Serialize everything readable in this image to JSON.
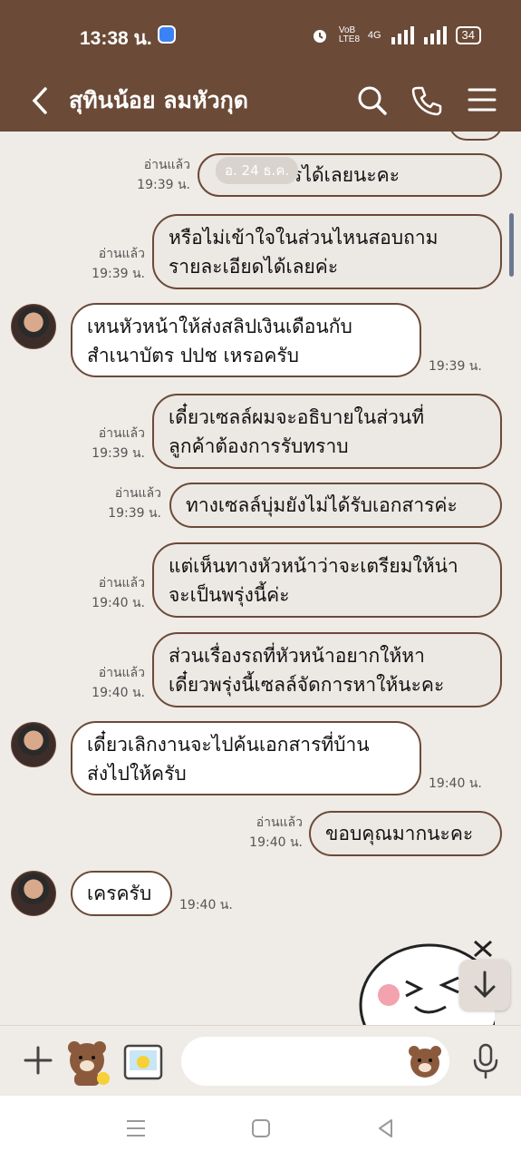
{
  "status": {
    "time": "13:38 น.",
    "network1": "VoB LTE8",
    "network2": "4G",
    "battery": "34"
  },
  "header": {
    "contact_name": "สุทินน้อย ลมหัวกุด"
  },
  "chat": {
    "date_label": "อ. 24 ธ.ค.",
    "messages": [
      {
        "dir": "out",
        "text": "ส่งเอกสารได้เลยนะคะ",
        "read": "อ่านแล้ว",
        "time": "19:39 น."
      },
      {
        "dir": "out",
        "lines": [
          "หรือไม่เข้าใจในส่วนไหนสอบถาม",
          "รายละเอียดได้เลยค่ะ"
        ],
        "read": "อ่านแล้ว",
        "time": "19:39 น."
      },
      {
        "dir": "in",
        "lines": [
          "เหนหัวหน้าให้ส่งสลิปเงินเดือนกับ",
          "สำเนาบัตร ปปช เหรอครับ"
        ],
        "time": "19:39 น."
      },
      {
        "dir": "out",
        "lines": [
          "เดี๋ยวเซลล์ผมจะอธิบายในส่วนที่",
          "ลูกค้าต้องการรับทราบ"
        ],
        "read": "อ่านแล้ว",
        "time": "19:39 น."
      },
      {
        "dir": "out",
        "text": "ทางเซลล์บุ่มยังไม่ได้รับเอกสารค่ะ",
        "read": "อ่านแล้ว",
        "time": "19:39 น."
      },
      {
        "dir": "out",
        "lines": [
          "แต่เห็นทางหัวหน้าว่าจะเตรียมให้น่า",
          "จะเป็นพรุ่งนี้ค่ะ"
        ],
        "read": "อ่านแล้ว",
        "time": "19:40 น."
      },
      {
        "dir": "out",
        "lines": [
          "ส่วนเรื่องรถที่หัวหน้าอยากให้หา",
          "เดี๋ยวพรุ่งนี้เซลล์จัดการหาให้นะคะ"
        ],
        "read": "อ่านแล้ว",
        "time": "19:40 น."
      },
      {
        "dir": "in",
        "lines": [
          "เดี๋ยวเลิกงานจะไปค้นเอกสารที่บ้าน",
          "ส่งไปให้ครับ"
        ],
        "time": "19:40 น."
      },
      {
        "dir": "out",
        "text": "ขอบคุณมากนะคะ",
        "read": "อ่านแล้ว",
        "time": "19:40 น."
      },
      {
        "dir": "in",
        "text": "เครครับ",
        "time": "19:40 น."
      }
    ]
  },
  "input": {
    "placeholder": ""
  },
  "colors": {
    "brand": "#6b4a37",
    "background": "#efebe7",
    "outgoing_bubble": "#ece8e4",
    "incoming_bubble": "#ffffff"
  },
  "icons": [
    "back-icon",
    "search-icon",
    "phone-icon",
    "menu-icon",
    "plus-icon",
    "sticker-icon",
    "photo-icon",
    "emoji-icon",
    "mic-icon",
    "scroll-down-icon"
  ]
}
